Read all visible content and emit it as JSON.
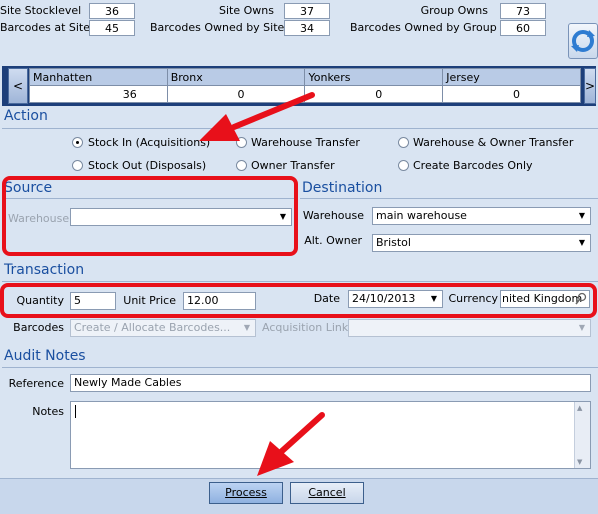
{
  "stats": {
    "site_stocklevel_label": "Site Stocklevel",
    "site_stocklevel": "36",
    "barcodes_at_site_label": "Barcodes at Site",
    "barcodes_at_site": "45",
    "site_owns_label": "Site Owns",
    "site_owns": "37",
    "barcodes_owned_by_site_label": "Barcodes Owned by Site",
    "barcodes_owned_by_site": "34",
    "group_owns_label": "Group Owns",
    "group_owns": "73",
    "barcodes_owned_by_group_label": "Barcodes Owned by Group",
    "barcodes_owned_by_group": "60"
  },
  "sites": {
    "prev": "<",
    "next": ">",
    "columns": [
      {
        "name": "Manhatten",
        "value": "36"
      },
      {
        "name": "Bronx",
        "value": "0"
      },
      {
        "name": "Yonkers",
        "value": "0"
      },
      {
        "name": "Jersey",
        "value": "0"
      }
    ]
  },
  "action": {
    "title": "Action",
    "options": [
      {
        "label": "Stock In (Acquisitions)",
        "selected": true
      },
      {
        "label": "Warehouse Transfer",
        "selected": false
      },
      {
        "label": "Warehouse & Owner Transfer",
        "selected": false
      },
      {
        "label": "Stock Out (Disposals)",
        "selected": false
      },
      {
        "label": "Owner Transfer",
        "selected": false
      },
      {
        "label": "Create Barcodes Only",
        "selected": false
      }
    ]
  },
  "source": {
    "title": "Source",
    "warehouse_label": "Warehouse",
    "warehouse_value": ""
  },
  "destination": {
    "title": "Destination",
    "warehouse_label": "Warehouse",
    "warehouse_value": "main warehouse",
    "alt_owner_label": "Alt. Owner",
    "alt_owner_value": "Bristol"
  },
  "transaction": {
    "title": "Transaction",
    "quantity_label": "Quantity",
    "quantity": "5",
    "unit_price_label": "Unit Price",
    "unit_price": "12.00",
    "date_label": "Date",
    "date": "24/10/2013",
    "currency_label": "Currency",
    "currency": "nited Kingdom",
    "barcodes_label": "Barcodes",
    "barcodes_value": "Create / Allocate Barcodes...",
    "acquisition_link_label": "Acquisition Link",
    "acquisition_link_value": ""
  },
  "audit": {
    "title": "Audit Notes",
    "reference_label": "Reference",
    "reference": "Newly Made Cables",
    "notes_label": "Notes",
    "notes": ""
  },
  "buttons": {
    "process": "Process",
    "cancel": "Cancel"
  },
  "colors": {
    "annotation_red": "#e8101a",
    "section_title": "#1a4fa0",
    "background": "#d9e4f2"
  }
}
